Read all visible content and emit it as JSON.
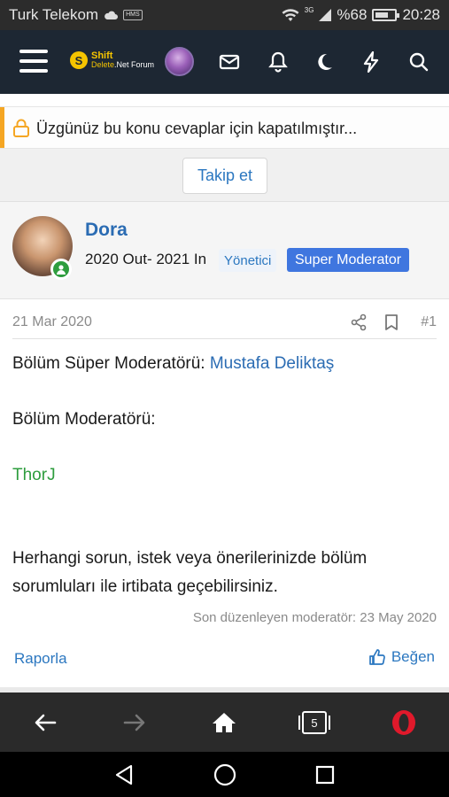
{
  "status_bar": {
    "carrier": "Turk Telekom",
    "hms_badge": "HMS",
    "network": "3G",
    "battery_text": "%68",
    "battery_level": 0.68,
    "time": "20:28"
  },
  "header": {
    "logo": {
      "mark": "S",
      "line1": "Shift",
      "line2_a": "Delete",
      "line2_b": ".Net",
      "line2_c": " Forum"
    },
    "icons": [
      "menu-icon",
      "avatar",
      "mail-icon",
      "bell-icon",
      "moon-icon",
      "bolt-icon",
      "search-icon"
    ]
  },
  "notice": {
    "text": "Üzgünüz bu konu cevaplar için kapatılmıştır..."
  },
  "follow": {
    "label": "Takip et"
  },
  "user": {
    "name": "Dora",
    "meta": "2020 Out- 2021 In",
    "roles": [
      "Yönetici",
      "Super Moderator"
    ]
  },
  "post": {
    "date": "21 Mar 2020",
    "number": "#1",
    "lines": {
      "super_mod_label": "Bölüm Süper Moderatörü: ",
      "super_mod_name": "Mustafa Deliktaş",
      "mod_label": "Bölüm Moderatörü:",
      "mod_name": "ThorJ",
      "closing_1": "Herhangi sorun, istek veya önerilerinizde bölüm",
      "closing_2": "sorumluları ile irtibata geçebilirsiniz."
    },
    "edited": "Son düzenleyen moderatör: 23 May 2020",
    "report": "Raporla",
    "like": "Beğen"
  },
  "browser_bar": {
    "tab_count": "5"
  },
  "colors": {
    "header_bg": "#1d2733",
    "accent_blue": "#2b77c0",
    "green": "#2e9d3e",
    "badge_blue": "#3f76df",
    "notice_orange": "#f5a623",
    "opera_red": "#e0192b"
  }
}
